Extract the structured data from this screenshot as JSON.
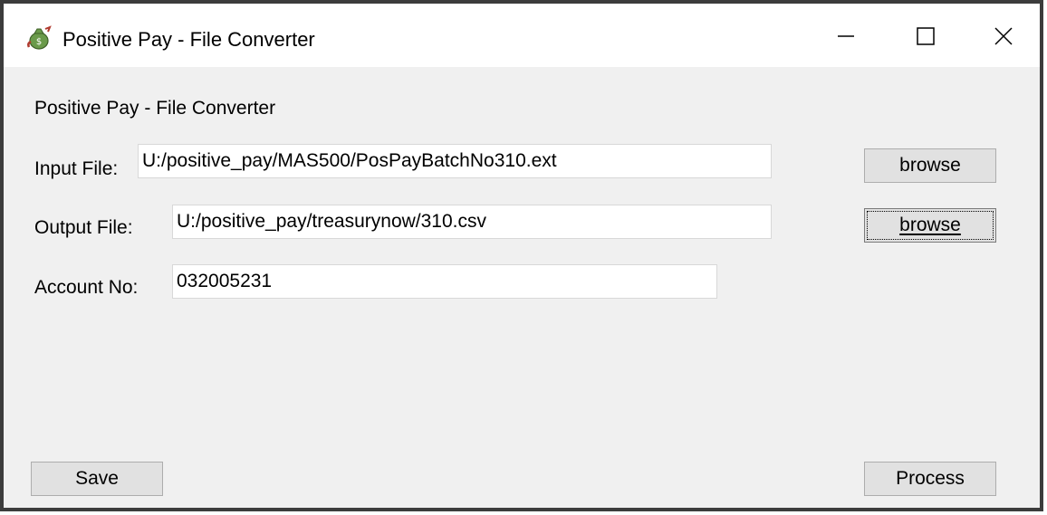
{
  "window": {
    "title": "Positive Pay - File Converter",
    "icon": "money-bag-icon",
    "controls": {
      "minimize": "minimize-icon",
      "maximize": "maximize-icon",
      "close": "close-icon"
    }
  },
  "main": {
    "heading": "Positive Pay - File Converter",
    "input_file": {
      "label": "Input File:",
      "value": "U:/positive_pay/MAS500/PosPayBatchNo310.ext",
      "browse_label": "browse"
    },
    "output_file": {
      "label": "Output File:",
      "value": "U:/positive_pay/treasurynow/310.csv",
      "browse_label": "browse"
    },
    "account": {
      "label": "Account No:",
      "value": "032005231"
    },
    "save_label": "Save",
    "process_label": "Process"
  },
  "colors": {
    "client_bg": "#f0f0f0",
    "titlebar_bg": "#ffffff",
    "button_bg": "#e1e1e1",
    "icon_green": "#5a8a3a",
    "icon_red": "#b03a2e"
  }
}
